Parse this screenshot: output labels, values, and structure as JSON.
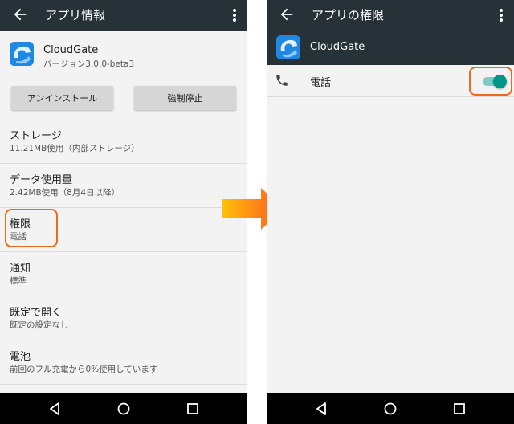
{
  "colors": {
    "appbar": "#263238",
    "accent_toggle": "#009688",
    "highlight": "#ee6a1a",
    "arrow_start": "#ffc107",
    "arrow_end": "#ff5722"
  },
  "left_screen": {
    "title": "アプリ情報",
    "app": {
      "name": "CloudGate",
      "version": "バージョン3.0.0-beta3"
    },
    "buttons": {
      "uninstall": "アンインストール",
      "force_stop": "強制停止"
    },
    "rows": [
      {
        "title": "ストレージ",
        "subtitle": "11.21MB使用（内部ストレージ）"
      },
      {
        "title": "データ使用量",
        "subtitle": "2.42MB使用（8月4日以降）"
      },
      {
        "title": "権限",
        "subtitle": "電話"
      },
      {
        "title": "通知",
        "subtitle": "標準"
      },
      {
        "title": "既定で開く",
        "subtitle": "既定の設定なし"
      },
      {
        "title": "電池",
        "subtitle": "前回のフル充電から0%使用しています"
      }
    ]
  },
  "right_screen": {
    "title": "アプリの権限",
    "app_name": "CloudGate",
    "permission": {
      "label": "電話",
      "enabled": true
    }
  },
  "icons": [
    "back-arrow-icon",
    "more-vert-icon",
    "cloudgate-app-icon",
    "phone-icon",
    "nav-back-icon",
    "nav-home-icon",
    "nav-recents-icon",
    "right-arrow-icon"
  ]
}
